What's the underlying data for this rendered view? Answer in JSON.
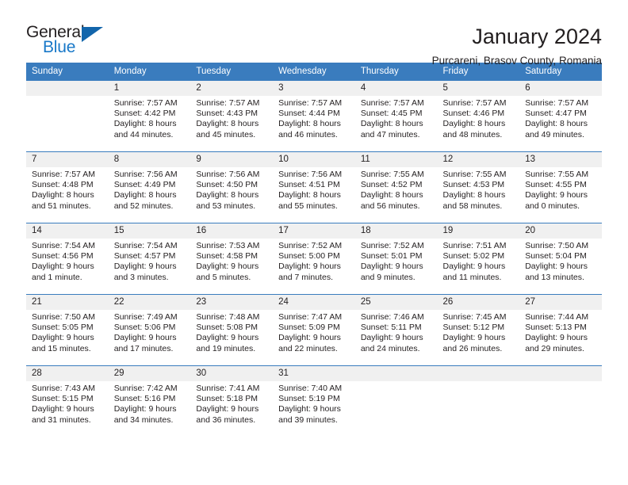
{
  "brand": {
    "name_part1": "General",
    "name_part2": "Blue",
    "triangle_color": "#1265ab",
    "blue_text_color": "#1878c8"
  },
  "header": {
    "title": "January 2024",
    "subtitle": "Purcareni, Brasov County, Romania"
  },
  "calendar": {
    "header_bg": "#3a7cbe",
    "daynum_bg": "#f0f0f0",
    "weekday_headers": [
      "Sunday",
      "Monday",
      "Tuesday",
      "Wednesday",
      "Thursday",
      "Friday",
      "Saturday"
    ],
    "weeks": [
      [
        {
          "day": "",
          "lines": []
        },
        {
          "day": "1",
          "lines": [
            "Sunrise: 7:57 AM",
            "Sunset: 4:42 PM",
            "Daylight: 8 hours",
            "and 44 minutes."
          ]
        },
        {
          "day": "2",
          "lines": [
            "Sunrise: 7:57 AM",
            "Sunset: 4:43 PM",
            "Daylight: 8 hours",
            "and 45 minutes."
          ]
        },
        {
          "day": "3",
          "lines": [
            "Sunrise: 7:57 AM",
            "Sunset: 4:44 PM",
            "Daylight: 8 hours",
            "and 46 minutes."
          ]
        },
        {
          "day": "4",
          "lines": [
            "Sunrise: 7:57 AM",
            "Sunset: 4:45 PM",
            "Daylight: 8 hours",
            "and 47 minutes."
          ]
        },
        {
          "day": "5",
          "lines": [
            "Sunrise: 7:57 AM",
            "Sunset: 4:46 PM",
            "Daylight: 8 hours",
            "and 48 minutes."
          ]
        },
        {
          "day": "6",
          "lines": [
            "Sunrise: 7:57 AM",
            "Sunset: 4:47 PM",
            "Daylight: 8 hours",
            "and 49 minutes."
          ]
        }
      ],
      [
        {
          "day": "7",
          "lines": [
            "Sunrise: 7:57 AM",
            "Sunset: 4:48 PM",
            "Daylight: 8 hours",
            "and 51 minutes."
          ]
        },
        {
          "day": "8",
          "lines": [
            "Sunrise: 7:56 AM",
            "Sunset: 4:49 PM",
            "Daylight: 8 hours",
            "and 52 minutes."
          ]
        },
        {
          "day": "9",
          "lines": [
            "Sunrise: 7:56 AM",
            "Sunset: 4:50 PM",
            "Daylight: 8 hours",
            "and 53 minutes."
          ]
        },
        {
          "day": "10",
          "lines": [
            "Sunrise: 7:56 AM",
            "Sunset: 4:51 PM",
            "Daylight: 8 hours",
            "and 55 minutes."
          ]
        },
        {
          "day": "11",
          "lines": [
            "Sunrise: 7:55 AM",
            "Sunset: 4:52 PM",
            "Daylight: 8 hours",
            "and 56 minutes."
          ]
        },
        {
          "day": "12",
          "lines": [
            "Sunrise: 7:55 AM",
            "Sunset: 4:53 PM",
            "Daylight: 8 hours",
            "and 58 minutes."
          ]
        },
        {
          "day": "13",
          "lines": [
            "Sunrise: 7:55 AM",
            "Sunset: 4:55 PM",
            "Daylight: 9 hours",
            "and 0 minutes."
          ]
        }
      ],
      [
        {
          "day": "14",
          "lines": [
            "Sunrise: 7:54 AM",
            "Sunset: 4:56 PM",
            "Daylight: 9 hours",
            "and 1 minute."
          ]
        },
        {
          "day": "15",
          "lines": [
            "Sunrise: 7:54 AM",
            "Sunset: 4:57 PM",
            "Daylight: 9 hours",
            "and 3 minutes."
          ]
        },
        {
          "day": "16",
          "lines": [
            "Sunrise: 7:53 AM",
            "Sunset: 4:58 PM",
            "Daylight: 9 hours",
            "and 5 minutes."
          ]
        },
        {
          "day": "17",
          "lines": [
            "Sunrise: 7:52 AM",
            "Sunset: 5:00 PM",
            "Daylight: 9 hours",
            "and 7 minutes."
          ]
        },
        {
          "day": "18",
          "lines": [
            "Sunrise: 7:52 AM",
            "Sunset: 5:01 PM",
            "Daylight: 9 hours",
            "and 9 minutes."
          ]
        },
        {
          "day": "19",
          "lines": [
            "Sunrise: 7:51 AM",
            "Sunset: 5:02 PM",
            "Daylight: 9 hours",
            "and 11 minutes."
          ]
        },
        {
          "day": "20",
          "lines": [
            "Sunrise: 7:50 AM",
            "Sunset: 5:04 PM",
            "Daylight: 9 hours",
            "and 13 minutes."
          ]
        }
      ],
      [
        {
          "day": "21",
          "lines": [
            "Sunrise: 7:50 AM",
            "Sunset: 5:05 PM",
            "Daylight: 9 hours",
            "and 15 minutes."
          ]
        },
        {
          "day": "22",
          "lines": [
            "Sunrise: 7:49 AM",
            "Sunset: 5:06 PM",
            "Daylight: 9 hours",
            "and 17 minutes."
          ]
        },
        {
          "day": "23",
          "lines": [
            "Sunrise: 7:48 AM",
            "Sunset: 5:08 PM",
            "Daylight: 9 hours",
            "and 19 minutes."
          ]
        },
        {
          "day": "24",
          "lines": [
            "Sunrise: 7:47 AM",
            "Sunset: 5:09 PM",
            "Daylight: 9 hours",
            "and 22 minutes."
          ]
        },
        {
          "day": "25",
          "lines": [
            "Sunrise: 7:46 AM",
            "Sunset: 5:11 PM",
            "Daylight: 9 hours",
            "and 24 minutes."
          ]
        },
        {
          "day": "26",
          "lines": [
            "Sunrise: 7:45 AM",
            "Sunset: 5:12 PM",
            "Daylight: 9 hours",
            "and 26 minutes."
          ]
        },
        {
          "day": "27",
          "lines": [
            "Sunrise: 7:44 AM",
            "Sunset: 5:13 PM",
            "Daylight: 9 hours",
            "and 29 minutes."
          ]
        }
      ],
      [
        {
          "day": "28",
          "lines": [
            "Sunrise: 7:43 AM",
            "Sunset: 5:15 PM",
            "Daylight: 9 hours",
            "and 31 minutes."
          ]
        },
        {
          "day": "29",
          "lines": [
            "Sunrise: 7:42 AM",
            "Sunset: 5:16 PM",
            "Daylight: 9 hours",
            "and 34 minutes."
          ]
        },
        {
          "day": "30",
          "lines": [
            "Sunrise: 7:41 AM",
            "Sunset: 5:18 PM",
            "Daylight: 9 hours",
            "and 36 minutes."
          ]
        },
        {
          "day": "31",
          "lines": [
            "Sunrise: 7:40 AM",
            "Sunset: 5:19 PM",
            "Daylight: 9 hours",
            "and 39 minutes."
          ]
        },
        {
          "day": "",
          "lines": []
        },
        {
          "day": "",
          "lines": []
        },
        {
          "day": "",
          "lines": []
        }
      ]
    ]
  }
}
